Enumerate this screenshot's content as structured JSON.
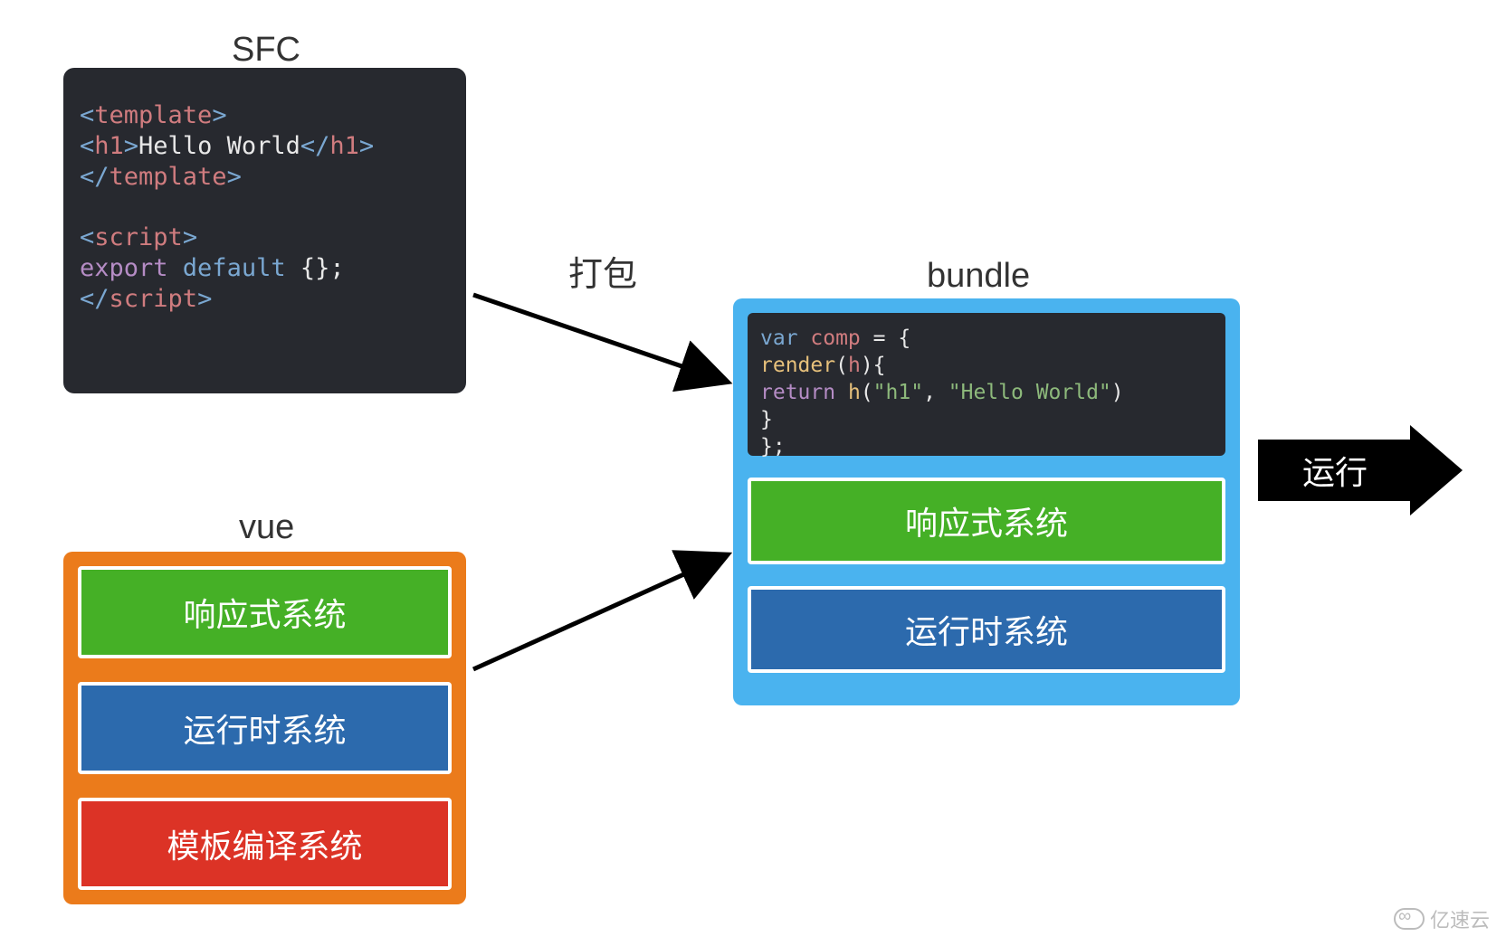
{
  "labels": {
    "sfc": "SFC",
    "vue": "vue",
    "bundle_action": "打包",
    "bundle": "bundle",
    "run": "运行"
  },
  "sfc_code": {
    "line1_open": "<",
    "line1_tag": "template",
    "line1_close": ">",
    "line2_indent": "  ",
    "line2_open1": "<",
    "line2_tag1": "h1",
    "line2_close1": ">",
    "line2_text": "Hello World",
    "line2_open2": "</",
    "line2_tag2": "h1",
    "line2_close2": ">",
    "line3_open": "</",
    "line3_tag": "template",
    "line3_close": ">",
    "line5_open": "<",
    "line5_tag": "script",
    "line5_close": ">",
    "line6_kw": "export ",
    "line6_def": "default ",
    "line6_rest": "{};",
    "line7_open": "</",
    "line7_tag": "script",
    "line7_close": ">"
  },
  "vue_boxes": {
    "reactive": "响应式系统",
    "runtime": "运行时系统",
    "compiler": "模板编译系统"
  },
  "bundle_code": {
    "l1a": "var",
    "l1b": " comp ",
    "l1c": "= {",
    "l2a": "  ",
    "l2b": "render",
    "l2c": "(",
    "l2d": "h",
    "l2e": "){",
    "l3a": "    ",
    "l3b": "return",
    "l3c": " ",
    "l3d": "h",
    "l3e": "(",
    "l3f": "\"h1\"",
    "l3g": ", ",
    "l3h": "\"Hello World\"",
    "l3i": ")",
    "l4": "  }",
    "l5": "};"
  },
  "bundle_boxes": {
    "reactive": "响应式系统",
    "runtime": "运行时系统"
  },
  "watermark": "亿速云",
  "colors": {
    "code_bg": "#27292f",
    "orange": "#eb7b1b",
    "green": "#45b026",
    "blue": "#2c6aad",
    "red": "#dc3326",
    "lightblue": "#4ab3ef"
  }
}
